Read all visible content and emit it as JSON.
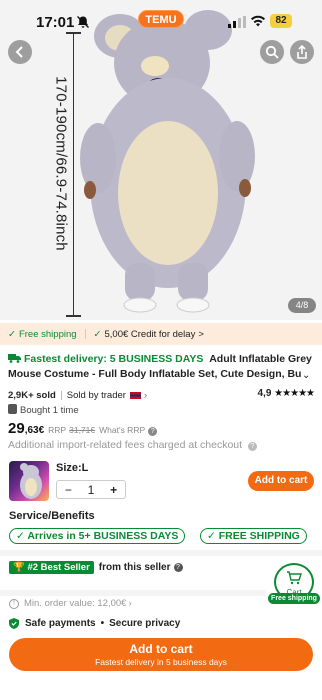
{
  "status_bar": {
    "time": "17:01",
    "temu_label": "TEMU",
    "battery": "82"
  },
  "hero": {
    "measurement": "170-190cm/66.9-74.8inch",
    "pager": "4/8"
  },
  "promo": {
    "free_shipping": "Free shipping",
    "credit": "5,00€ Credit for delay",
    "credit_chevron": ">"
  },
  "title": {
    "fast_delivery": "Fastest delivery: 5 BUSINESS DAYS",
    "product_name": "Adult Inflatable Grey Mouse Costume - Full Body Inflatable Set, Cute Design, Bu",
    "chevron": "⌄"
  },
  "meta": {
    "sold": "2,9K+ sold",
    "seller": "Sold by trader",
    "rating": "4,9",
    "stars": "★★★★★",
    "bought": "Bought 1 time"
  },
  "price": {
    "main": "29",
    "decimals": ",63€",
    "rrp": "RRP",
    "rrp_value": "31,71€",
    "whats_rrp": "What's RRP",
    "fees": "Additional import-related fees charged at checkout"
  },
  "variant": {
    "size": "Size:L",
    "minus": "−",
    "quantity": "1",
    "plus": "+",
    "add_to_cart": "Add to cart"
  },
  "service": {
    "title": "Service/Benefits",
    "pill_1": "✓ Arrives in 5+ BUSINESS DAYS",
    "pill_2": "✓ FREE SHIPPING"
  },
  "seller_row": {
    "badge": "#2 Best Seller",
    "text": "from this seller"
  },
  "cart_float": {
    "label": "Cart",
    "badge": "Free shipping"
  },
  "min_order": "Min. order value: 12,00€",
  "safe": {
    "payments": "Safe payments",
    "dot": "•",
    "privacy": "Secure privacy"
  },
  "bottom_cta": {
    "label": "Add to cart",
    "sub": "Fastest delivery in 5 business days"
  },
  "colors": {
    "accent": "#f26b12",
    "green": "#0a8a35",
    "promo_bg": "#fdecdc"
  }
}
